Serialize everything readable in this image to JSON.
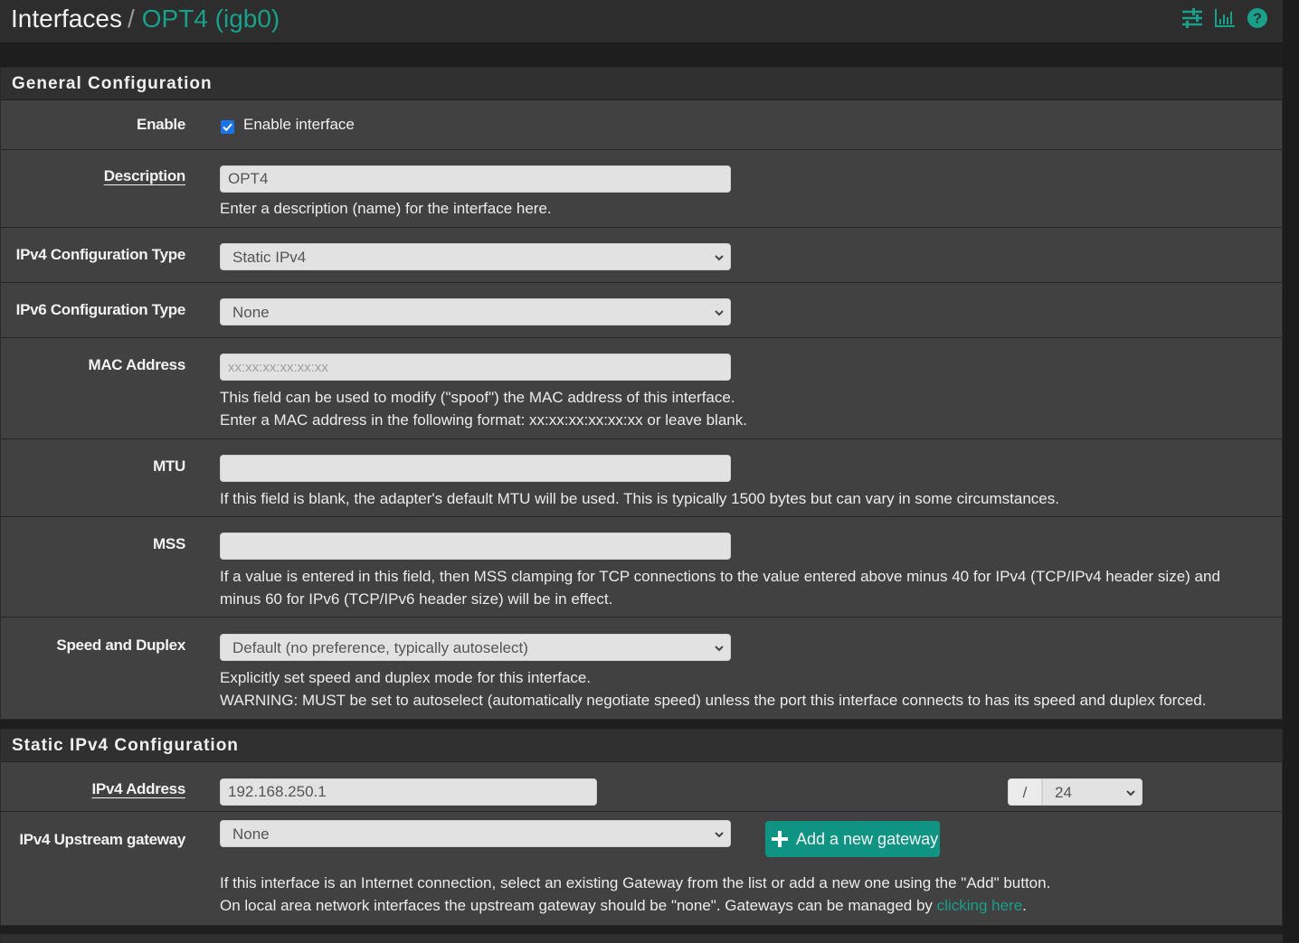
{
  "header": {
    "breadcrumb_root": "Interfaces",
    "breadcrumb_sep": "/",
    "breadcrumb_current": "OPT4 (igb0)",
    "icons": [
      "sliders-icon",
      "bar-chart-icon",
      "help-icon"
    ]
  },
  "colors": {
    "accent": "#18a08a",
    "button": "#0f9483",
    "checkbox": "#1a73e8",
    "panel_bg": "#414141",
    "heading_bg": "#303030"
  },
  "general": {
    "heading": "General Configuration",
    "enable": {
      "label": "Enable",
      "checkbox_label": "Enable interface",
      "checked": true
    },
    "description": {
      "label": "Description",
      "value": "OPT4",
      "help": "Enter a description (name) for the interface here."
    },
    "ipv4_type": {
      "label": "IPv4 Configuration Type",
      "selected": "Static IPv4"
    },
    "ipv6_type": {
      "label": "IPv6 Configuration Type",
      "selected": "None"
    },
    "mac": {
      "label": "MAC Address",
      "value": "",
      "placeholder": "xx:xx:xx:xx:xx:xx",
      "help_line1": "This field can be used to modify (\"spoof\") the MAC address of this interface.",
      "help_line2": "Enter a MAC address in the following format: xx:xx:xx:xx:xx:xx or leave blank."
    },
    "mtu": {
      "label": "MTU",
      "value": "",
      "help": "If this field is blank, the adapter's default MTU will be used. This is typically 1500 bytes but can vary in some circumstances."
    },
    "mss": {
      "label": "MSS",
      "value": "",
      "help_line1": "If a value is entered in this field, then MSS clamping for TCP connections to the value entered above minus 40 for IPv4 (TCP/IPv4 header size) and",
      "help_line2": "minus 60 for IPv6 (TCP/IPv6 header size) will be in effect."
    },
    "speed": {
      "label": "Speed and Duplex",
      "selected": "Default (no preference, typically autoselect)",
      "help_line1": "Explicitly set speed and duplex mode for this interface.",
      "help_line2": "WARNING: MUST be set to autoselect (automatically negotiate speed) unless the port this interface connects to has its speed and duplex forced."
    }
  },
  "static_ipv4": {
    "heading": "Static IPv4 Configuration",
    "address": {
      "label": "IPv4 Address",
      "value": "192.168.250.1",
      "slash": "/",
      "mask": "24"
    },
    "gateway": {
      "label": "IPv4 Upstream gateway",
      "selected": "None",
      "add_button": "Add a new gateway",
      "help_line1": "If this interface is an Internet connection, select an existing Gateway from the list or add a new one using the \"Add\" button.",
      "help_line2_prefix": "On local area network interfaces the upstream gateway should be \"none\". Gateways can be managed by ",
      "help_link": "clicking here",
      "help_line2_suffix": "."
    }
  }
}
